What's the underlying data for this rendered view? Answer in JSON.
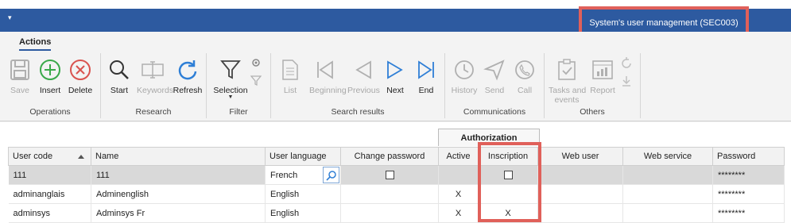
{
  "window": {
    "title": "System's user management (SEC003)"
  },
  "ribbon": {
    "tab": "Actions",
    "buttons": {
      "save": "Save",
      "insert": "Insert",
      "delete": "Delete",
      "start": "Start",
      "keywords": "Keywords",
      "refresh": "Refresh",
      "selection": "Selection",
      "list": "List",
      "beginning": "Beginning",
      "previous": "Previous",
      "next": "Next",
      "end": "End",
      "history": "History",
      "send": "Send",
      "call": "Call",
      "tasks": "Tasks and",
      "tasks2": "events",
      "report": "Report"
    },
    "groups": {
      "operations": "Operations",
      "research": "Research",
      "filter": "Filter",
      "search_results": "Search results",
      "communications": "Communications",
      "others": "Others"
    }
  },
  "grid": {
    "group_header": "Authorization",
    "columns": [
      "User code",
      "Name",
      "User language",
      "Change password",
      "Active",
      "Inscription",
      "Web user",
      "Web service",
      "Password"
    ],
    "rows": [
      {
        "code": "111",
        "name": "111",
        "language": "French",
        "active": "",
        "inscription": "",
        "password": "********"
      },
      {
        "code": "adminanglais",
        "name": "Adminenglish",
        "language": "English",
        "active": "X",
        "inscription": "",
        "password": "********"
      },
      {
        "code": "adminsys",
        "name": "Adminsys Fr",
        "language": "English",
        "active": "X",
        "inscription": "X",
        "password": "********"
      }
    ]
  },
  "colors": {
    "titlebar": "#2d5aa0",
    "highlight": "#e0605a",
    "accent_blue": "#2f7fd6",
    "insert_green": "#3aa94a",
    "delete_red": "#d9534f"
  }
}
